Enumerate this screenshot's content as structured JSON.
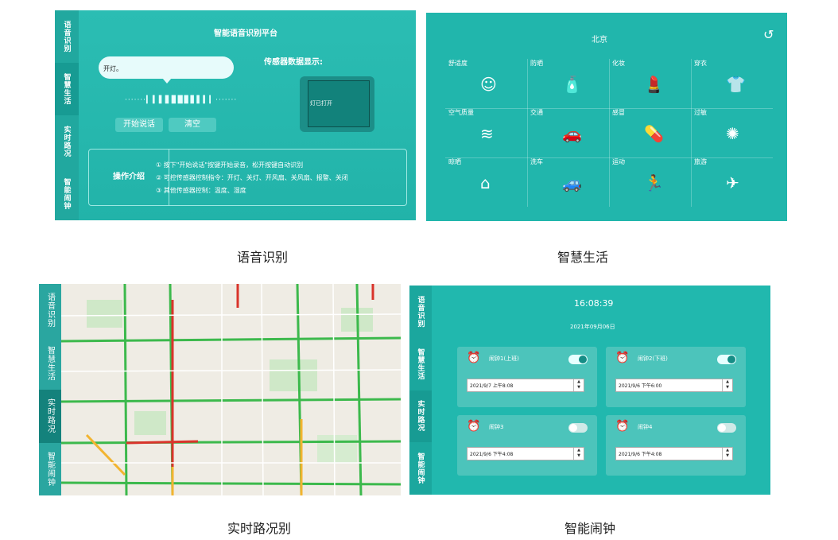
{
  "panels": {
    "voice": {
      "tabs": [
        "语音识别",
        "智慧生活",
        "实时路况",
        "智能闹钟"
      ],
      "title": "智能语音识别平台",
      "bubble_text": "开灯。",
      "start_button": "开始说话",
      "clear_button": "清空",
      "sensor_title": "传感器数据显示:",
      "sensor_value": "灯已打开",
      "intro_label": "操作介绍",
      "intro_lines": [
        "① 按下\"开始说话\"按键开始录音，松开按键自动识别",
        "② 可控传感器控制指令：开灯、关灯、开风扇、关风扇、报警、关闭",
        "③ 其他传感器控制：温度、湿度"
      ]
    },
    "life": {
      "city": "北京",
      "items": [
        {
          "label": "舒适度",
          "icon": "smile-icon"
        },
        {
          "label": "防晒",
          "icon": "sunscreen-icon"
        },
        {
          "label": "化妆",
          "icon": "cosmetics-icon"
        },
        {
          "label": "穿衣",
          "icon": "tshirt-icon"
        },
        {
          "label": "空气质量",
          "icon": "wind-icon"
        },
        {
          "label": "交通",
          "icon": "car-icon"
        },
        {
          "label": "感冒",
          "icon": "pill-icon"
        },
        {
          "label": "过敏",
          "icon": "virus-icon"
        },
        {
          "label": "晾晒",
          "icon": "hanger-icon"
        },
        {
          "label": "洗车",
          "icon": "carwash-icon"
        },
        {
          "label": "运动",
          "icon": "running-icon"
        },
        {
          "label": "旅游",
          "icon": "plane-icon"
        }
      ]
    },
    "traffic": {
      "tabs": [
        "语音识别",
        "智慧生活",
        "实时路况",
        "智能闹钟"
      ]
    },
    "alarm": {
      "tabs": [
        "语音识别",
        "智慧生活",
        "实时路况",
        "智能闹钟"
      ],
      "time": "16:08:39",
      "date": "2021年09月06日",
      "alarms": [
        {
          "name": "闹钟1(上班)",
          "datetime": "2021/9/7 上午8:08",
          "enabled": true
        },
        {
          "name": "闹钟2(下班)",
          "datetime": "2021/9/6 下午6:00",
          "enabled": true
        },
        {
          "name": "闹钟3",
          "datetime": "2021/9/6 下午4:08",
          "enabled": false
        },
        {
          "name": "闹钟4",
          "datetime": "2021/9/6 下午4:08",
          "enabled": false
        }
      ]
    }
  },
  "captions": [
    "语音识别",
    "智慧生活",
    "实时路况别",
    "智能闹钟"
  ],
  "colors": {
    "teal": "#24b7ad",
    "tab_active": "#179b93",
    "card": "#4cc4bb"
  }
}
